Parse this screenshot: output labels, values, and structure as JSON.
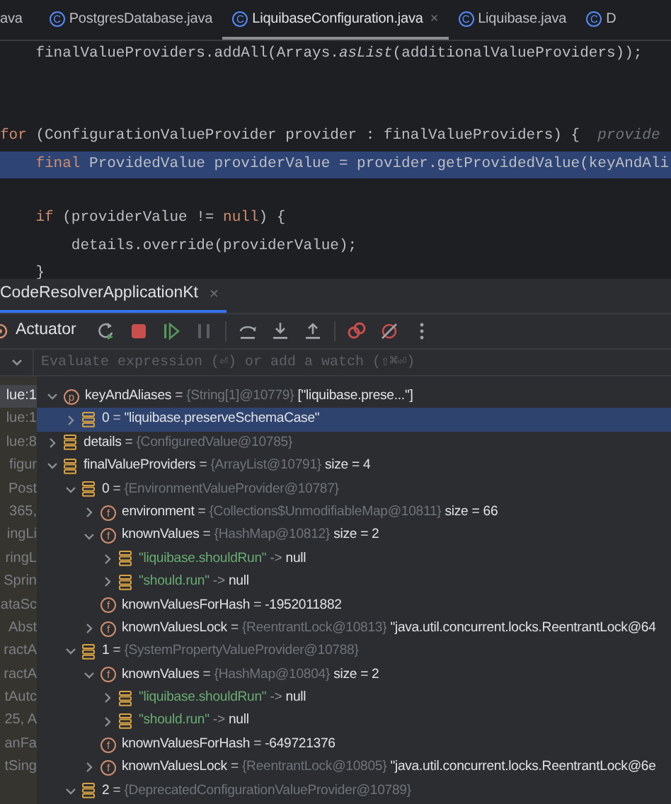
{
  "editor_tabs": [
    {
      "label": "ava",
      "selected": false
    },
    {
      "badge": "C",
      "label": "PostgresDatabase.java",
      "selected": false
    },
    {
      "badge": "C",
      "label": "LiquibaseConfiguration.java",
      "selected": true,
      "close": "×"
    },
    {
      "badge": "C",
      "label": "Liquibase.java",
      "selected": false
    },
    {
      "badge": "C",
      "label": "D",
      "selected": false
    }
  ],
  "code_lines": [
    {
      "highlighted": false,
      "tokens": [
        {
          "kind": "plain",
          "text": "    finalValueProviders.addAll(Arrays."
        },
        {
          "kind": "italic",
          "text": "asList"
        },
        {
          "kind": "plain",
          "text": "(additionalValueProviders));"
        }
      ]
    },
    {
      "highlighted": false
    },
    {
      "highlighted": false
    },
    {
      "highlighted": false,
      "tokens": [
        {
          "kind": "keyword",
          "text": "for"
        },
        {
          "kind": "plain",
          "text": " (ConfigurationValueProvider provider : finalValueProviders) {  "
        },
        {
          "kind": "hint",
          "text": "provide"
        }
      ]
    },
    {
      "highlighted": true,
      "tokens": [
        {
          "kind": "keyword",
          "text": "    final"
        },
        {
          "kind": "plain",
          "text": " ProvidedValue providerValue = provider.getProvidedValue(keyAndAli"
        }
      ]
    },
    {
      "highlighted": false
    },
    {
      "highlighted": false,
      "tokens": [
        {
          "kind": "keyword",
          "text": "    if"
        },
        {
          "kind": "plain",
          "text": " (providerValue != "
        },
        {
          "kind": "keyword",
          "text": "null"
        },
        {
          "kind": "plain",
          "text": ") {"
        }
      ]
    },
    {
      "highlighted": false,
      "tokens": [
        {
          "kind": "plain",
          "text": "        details.override(providerValue);"
        }
      ]
    },
    {
      "highlighted": false,
      "tokens": [
        {
          "kind": "plain",
          "text": "    }"
        }
      ]
    }
  ],
  "debug_tab": {
    "label": "CodeResolverApplicationKt",
    "close": "×",
    "selected": true
  },
  "toolbar": {
    "label": "Actuator",
    "buttons": [
      {
        "kind": "rerun"
      },
      {
        "kind": "stop"
      },
      {
        "kind": "resume"
      },
      {
        "kind": "pause"
      },
      {
        "kind": "step_over"
      },
      {
        "kind": "step_into"
      },
      {
        "kind": "step_out"
      },
      {
        "kind": "breakpoints"
      },
      {
        "kind": "mute"
      },
      {
        "kind": "more"
      }
    ]
  },
  "evaluate": {
    "placeholder": "Evaluate expression (⏎) or add a watch (⇧⌘⏎)"
  },
  "frames": [
    {
      "label": "lue:1",
      "selected": true
    },
    {
      "label": "lue:1",
      "selected": false
    },
    {
      "label": "lue:8",
      "selected": false
    },
    {
      "label": "figur",
      "selected": false
    },
    {
      "label": "Post",
      "selected": false
    },
    {
      "label": "365,",
      "selected": false
    },
    {
      "label": "ingLi",
      "selected": false
    },
    {
      "label": "ringL",
      "selected": false
    },
    {
      "label": "Sprin",
      "selected": false
    },
    {
      "label": "ataSc",
      "selected": false
    },
    {
      "label": "Abst",
      "selected": false
    },
    {
      "label": "ractA",
      "selected": false
    },
    {
      "label": "ractA",
      "selected": false
    },
    {
      "label": "tAutc",
      "selected": false
    },
    {
      "label": "25, A",
      "selected": false
    },
    {
      "label": "anFa",
      "selected": false
    },
    {
      "label": "tSing",
      "selected": false
    }
  ],
  "variables": [
    {
      "kind": "param",
      "badge": "p",
      "name": "keyAndAliases",
      "sep": "=",
      "type": "{String[1]@10779}",
      "value": "[\"liquibase.prese...\"]",
      "expanded": true,
      "selected": false,
      "children": [
        {
          "kind": "element",
          "name": "0",
          "sep": "=",
          "value": "\"liquibase.preserveSchemaCase\"",
          "expanded": false,
          "selected": true
        }
      ]
    },
    {
      "kind": "local",
      "name": "details",
      "sep": "=",
      "type": "{ConfiguredValue@10785}",
      "expanded": false,
      "selected": false
    },
    {
      "kind": "local",
      "name": "finalValueProviders",
      "sep": "=",
      "type": "{ArrayList@10791}",
      "value": "size = 4",
      "expanded": true,
      "selected": false,
      "children": [
        {
          "kind": "element",
          "name": "0",
          "sep": "=",
          "type": "{EnvironmentValueProvider@10787}",
          "expanded": true,
          "selected": false,
          "children": [
            {
              "kind": "field",
              "badge": "f",
              "name": "environment",
              "sep": "=",
              "type": "{Collections$UnmodifiableMap@10811}",
              "value": "size = 66",
              "expanded": false,
              "selected": false
            },
            {
              "kind": "field",
              "badge": "f",
              "name": "knownValues",
              "sep": "=",
              "type": "{HashMap@10812}",
              "value": "size = 2",
              "expanded": true,
              "selected": false,
              "children": [
                {
                  "kind": "entry",
                  "name": "\"liquibase.shouldRun\"",
                  "sep": "->",
                  "value": "null",
                  "expanded": false,
                  "selected": false
                },
                {
                  "kind": "entry",
                  "name": "\"should.run\"",
                  "sep": "->",
                  "value": "null",
                  "expanded": false,
                  "selected": false
                }
              ]
            },
            {
              "kind": "field",
              "badge": "f",
              "name": "knownValuesForHash",
              "sep": "=",
              "value": "-1952011882",
              "selected": false
            },
            {
              "kind": "field",
              "badge": "f",
              "name": "knownValuesLock",
              "sep": "=",
              "type": "{ReentrantLock@10813}",
              "value": "\"java.util.concurrent.locks.ReentrantLock@64",
              "expanded": false,
              "selected": false
            }
          ]
        },
        {
          "kind": "element",
          "name": "1",
          "sep": "=",
          "type": "{SystemPropertyValueProvider@10788}",
          "expanded": true,
          "selected": false,
          "children": [
            {
              "kind": "field",
              "badge": "f",
              "name": "knownValues",
              "sep": "=",
              "type": "{HashMap@10804}",
              "value": "size = 2",
              "expanded": true,
              "selected": false,
              "children": [
                {
                  "kind": "entry",
                  "name": "\"liquibase.shouldRun\"",
                  "sep": "->",
                  "value": "null",
                  "expanded": false,
                  "selected": false
                },
                {
                  "kind": "entry",
                  "name": "\"should.run\"",
                  "sep": "->",
                  "value": "null",
                  "expanded": false,
                  "selected": false
                }
              ]
            },
            {
              "kind": "field",
              "badge": "f",
              "name": "knownValuesForHash",
              "sep": "=",
              "value": "-649721376",
              "selected": false
            },
            {
              "kind": "field",
              "badge": "f",
              "name": "knownValuesLock",
              "sep": "=",
              "type": "{ReentrantLock@10805}",
              "value": "\"java.util.concurrent.locks.ReentrantLock@6e",
              "expanded": false,
              "selected": false
            }
          ]
        },
        {
          "kind": "element",
          "name": "2",
          "sep": "=",
          "type": "{DeprecatedConfigurationValueProvider@10789}",
          "expanded": true,
          "selected": false
        }
      ]
    }
  ]
}
